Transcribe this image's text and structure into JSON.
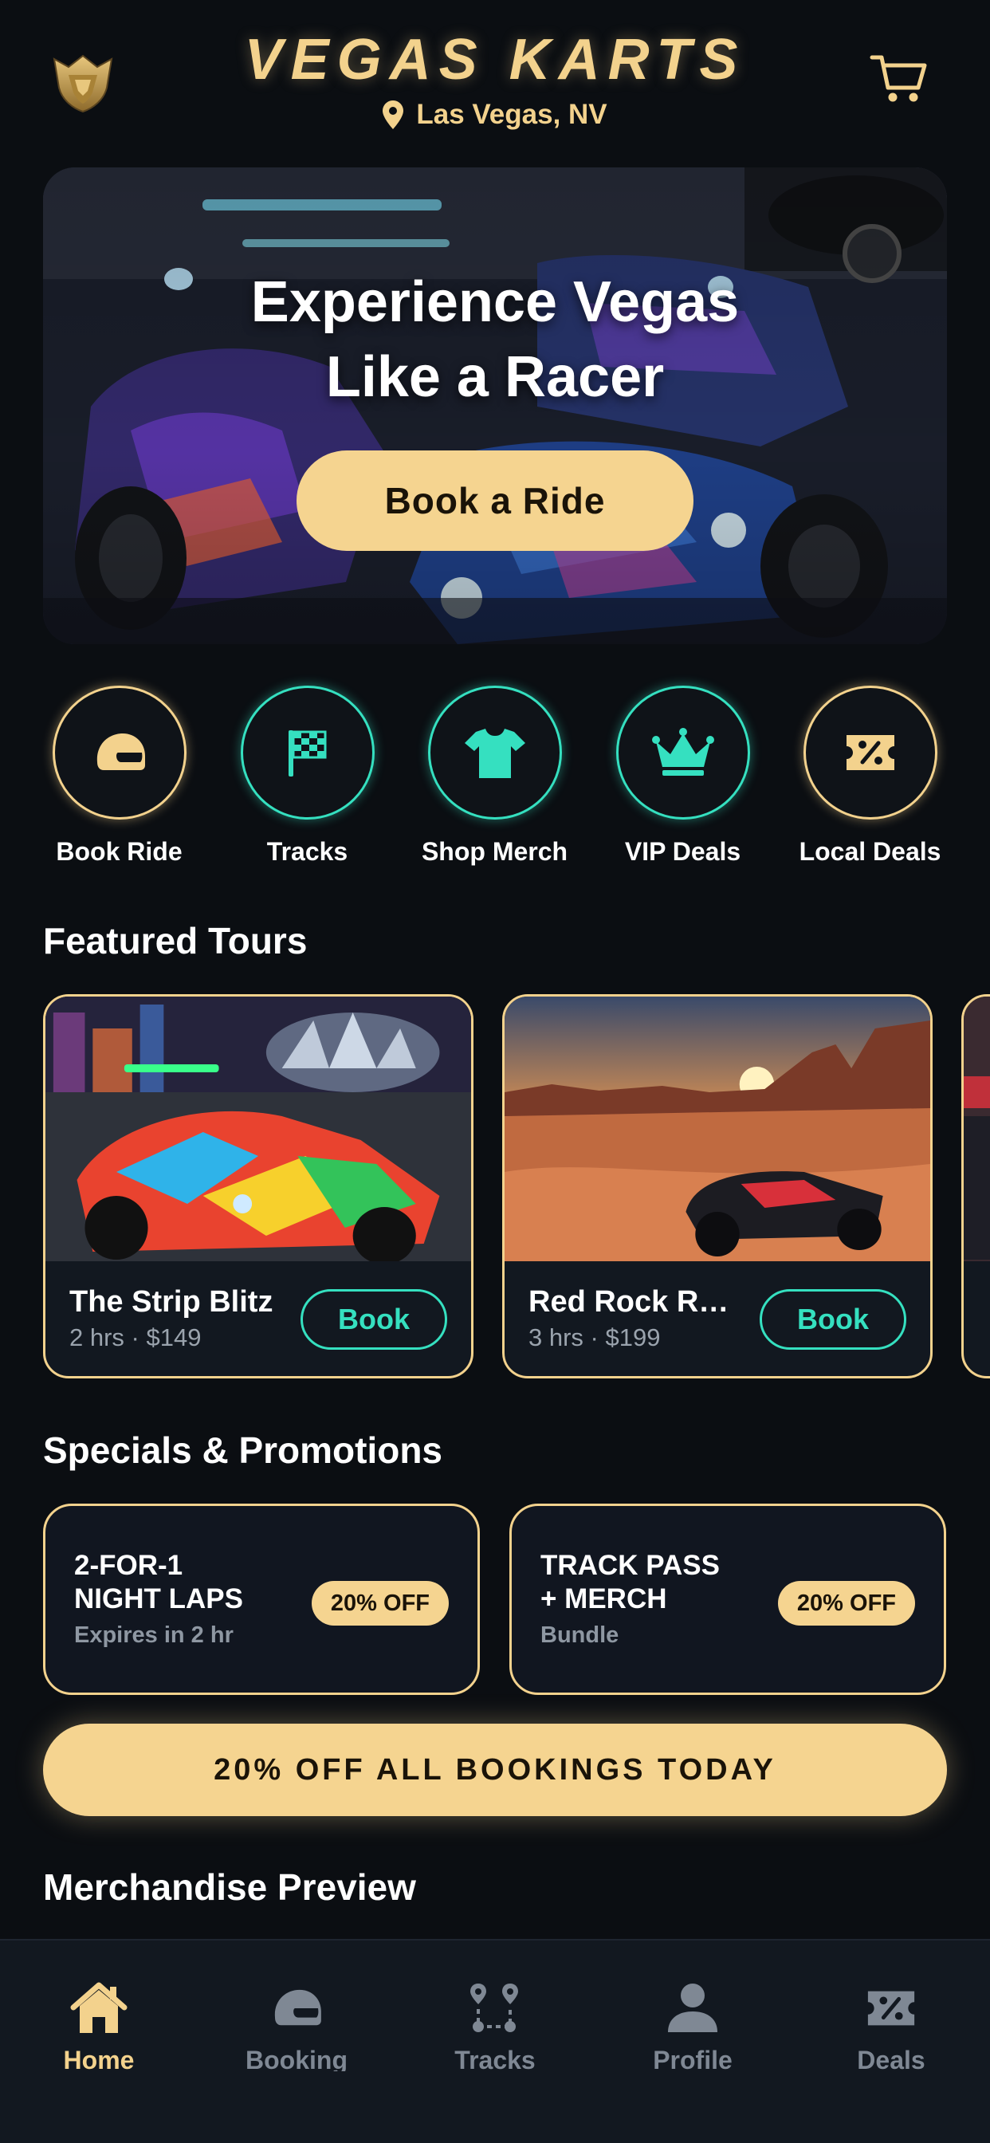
{
  "header": {
    "brand": "VEGAS KARTS",
    "location": "Las Vegas, NV"
  },
  "hero": {
    "title": "Experience Vegas\nLike a Racer",
    "cta": "Book a Ride"
  },
  "quick_actions": [
    {
      "label": "Book Ride",
      "icon": "helmet-icon",
      "style": "gold"
    },
    {
      "label": "Tracks",
      "icon": "checkered-flag-icon",
      "style": "teal"
    },
    {
      "label": "Shop Merch",
      "icon": "tshirt-icon",
      "style": "teal"
    },
    {
      "label": "VIP Deals",
      "icon": "crown-icon",
      "style": "teal"
    },
    {
      "label": "Local Deals",
      "icon": "percent-ticket-icon",
      "style": "gold"
    }
  ],
  "featured": {
    "title": "Featured Tours",
    "tours": [
      {
        "name": "The Strip Blitz",
        "meta": "2 hrs · $149",
        "button": "Book"
      },
      {
        "name": "Red Rock R…",
        "meta": "3 hrs · $199",
        "button": "Book"
      }
    ]
  },
  "specials": {
    "title": "Specials & Promotions",
    "promos": [
      {
        "title": "2-FOR-1\nNIGHT LAPS",
        "sub": "Expires in 2 hr",
        "badge": "20% OFF"
      },
      {
        "title": "TRACK PASS\n+ MERCH",
        "sub": "Bundle",
        "badge": "20% OFF"
      }
    ],
    "banner": "20% OFF ALL BOOKINGS TODAY"
  },
  "merch": {
    "title": "Merchandise Preview"
  },
  "bottom_nav": [
    {
      "label": "Home",
      "icon": "home-icon",
      "active": true
    },
    {
      "label": "Booking",
      "icon": "helmet-icon",
      "active": false
    },
    {
      "label": "Tracks",
      "icon": "route-icon",
      "active": false
    },
    {
      "label": "Profile",
      "icon": "user-icon",
      "active": false
    },
    {
      "label": "Deals",
      "icon": "percent-ticket-icon",
      "active": false
    }
  ],
  "colors": {
    "background": "#0b0e12",
    "gold": "#f3d28d",
    "teal": "#35e0c0",
    "muted": "#7f8894"
  }
}
